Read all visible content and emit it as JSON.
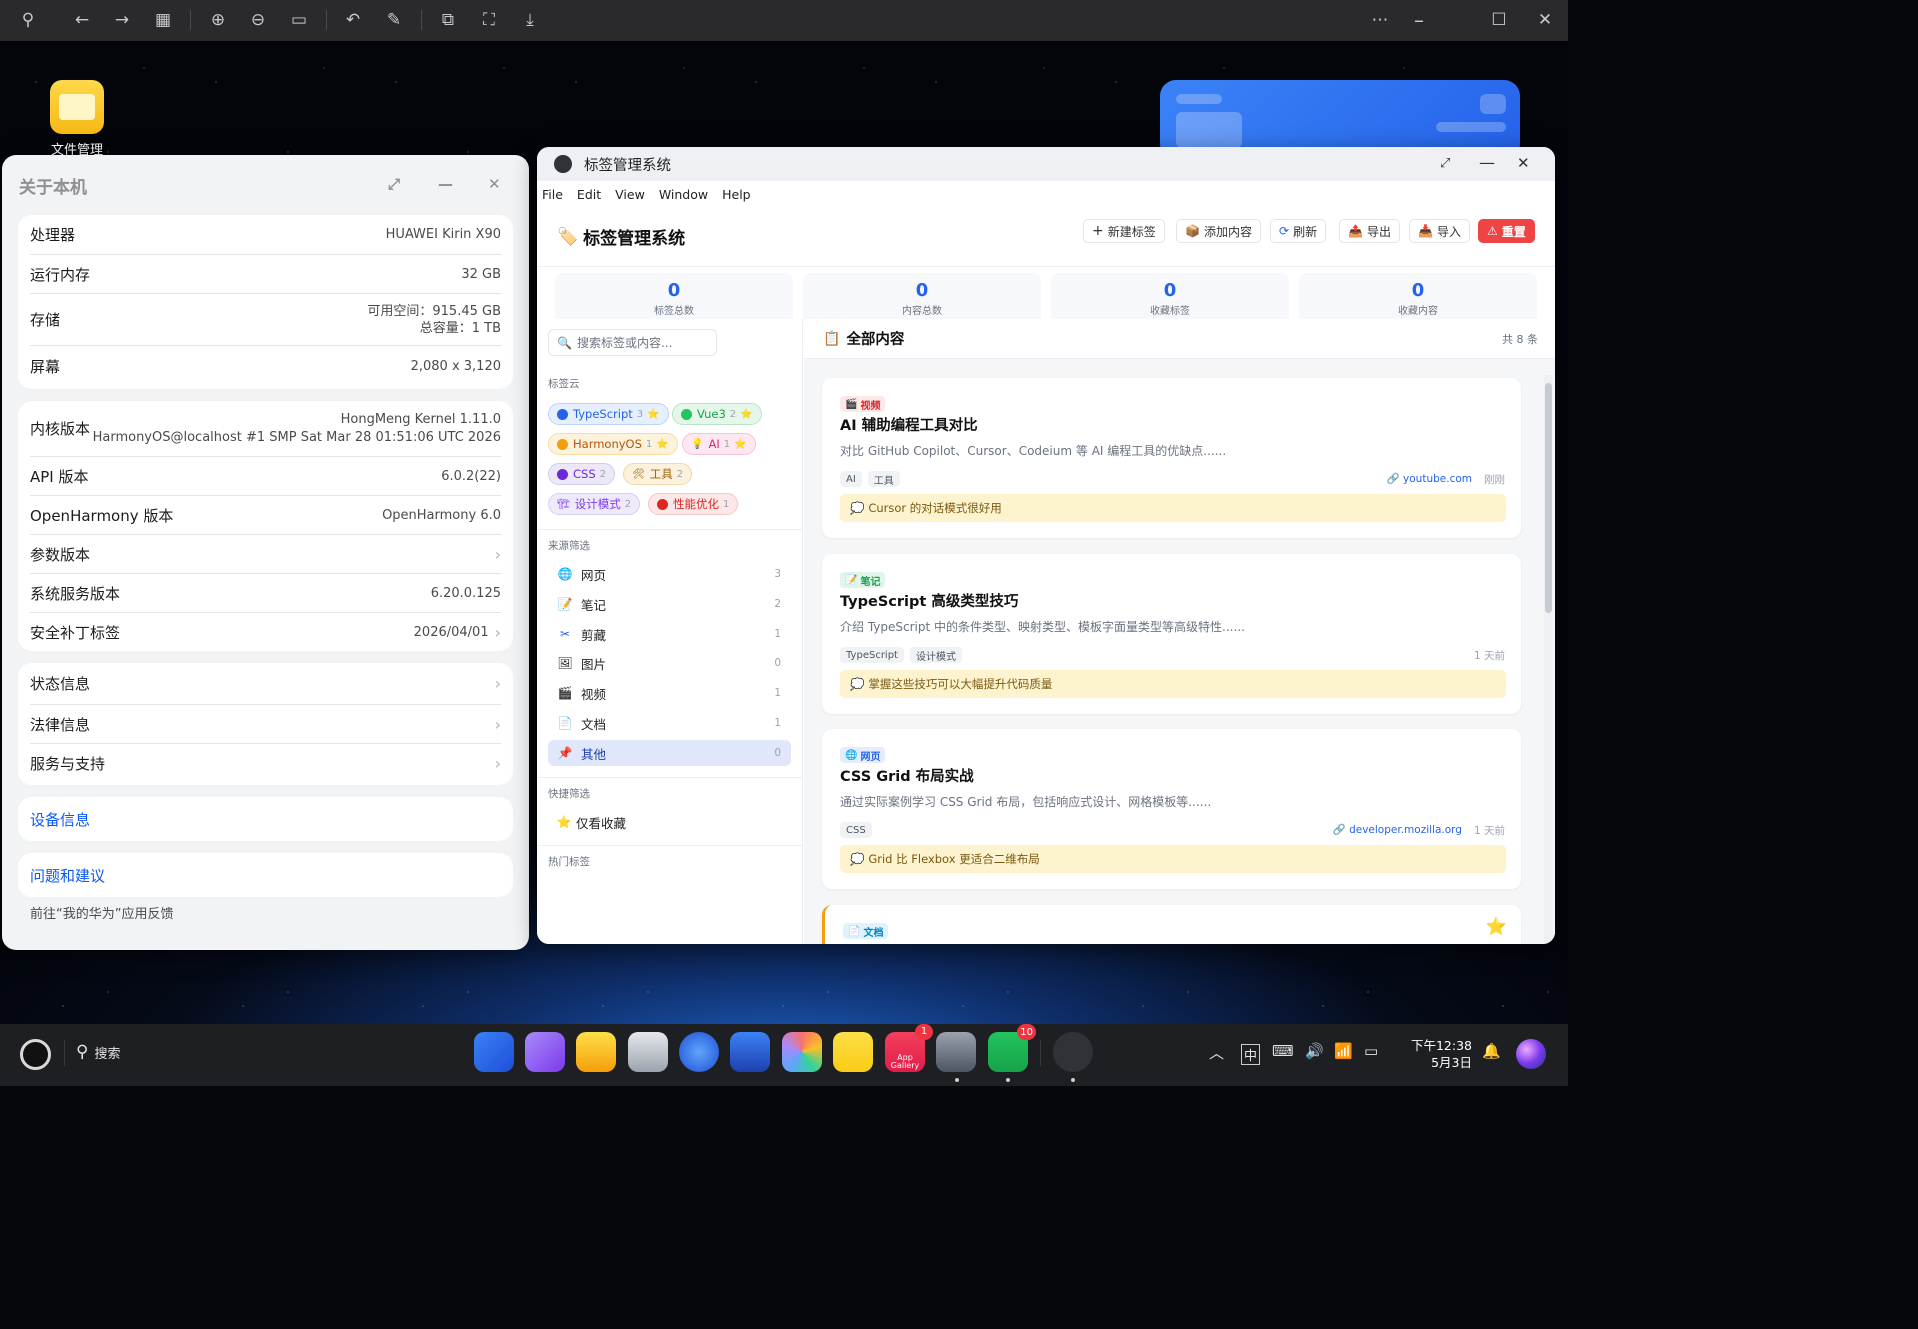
{
  "topbar": {
    "icons": [
      "pin-icon",
      "back-icon",
      "forward-icon",
      "grid-icon",
      "zoom-in-icon",
      "zoom-out-icon",
      "actual-size-icon",
      "rotate-icon",
      "edit-icon",
      "crop-icon",
      "fullscreen-icon",
      "download-icon",
      "more-icon",
      "minimize-icon",
      "maximize-icon",
      "close-icon"
    ]
  },
  "desktop": {
    "file_manager_label": "文件管理"
  },
  "about": {
    "title": "关于本机",
    "hardware": [
      {
        "key": "处理器",
        "value": "HUAWEI Kirin X90"
      },
      {
        "key": "运行内存",
        "value": "32 GB"
      },
      {
        "key": "存储",
        "value": "可用空间：915.45 GB",
        "value2": "总容量：1 TB"
      },
      {
        "key": "屏幕",
        "value": "2,080 x 3,120"
      }
    ],
    "software": [
      {
        "key": "内核版本",
        "value": "HongMeng Kernel 1.11.0",
        "value2": "HarmonyOS@localhost #1 SMP Sat Mar 28 01:51:06 UTC 2026"
      },
      {
        "key": "API 版本",
        "value": "6.0.2(22)"
      },
      {
        "key": "OpenHarmony 版本",
        "value": "OpenHarmony 6.0"
      },
      {
        "key": "参数版本",
        "value": ""
      },
      {
        "key": "系统服务版本",
        "value": "6.20.0.125"
      },
      {
        "key": "安全补丁标签",
        "value": "2026/04/01"
      }
    ],
    "info": [
      {
        "key": "状态信息"
      },
      {
        "key": "法律信息"
      },
      {
        "key": "服务与支持"
      }
    ],
    "device_info": "设备信息",
    "feedback": "问题和建议",
    "feedback_hint": "前往“我的华为”应用反馈"
  },
  "tagwin": {
    "window_title": "标签管理系统",
    "menu": [
      "File",
      "Edit",
      "View",
      "Window",
      "Help"
    ],
    "app_title": "标签管理系统",
    "buttons": {
      "new_tag": "新建标签",
      "add_content": "添加内容",
      "refresh": "刷新",
      "export": "导出",
      "import": "导入",
      "reset": "重置"
    },
    "stats": [
      {
        "value": "0",
        "label": "标签总数"
      },
      {
        "value": "0",
        "label": "内容总数"
      },
      {
        "value": "0",
        "label": "收藏标签"
      },
      {
        "value": "0",
        "label": "收藏内容"
      }
    ],
    "search_placeholder": "搜索标签或内容...",
    "tag_cloud_title": "标签云",
    "tags": [
      {
        "name": "TypeScript",
        "count": "3",
        "fav": true,
        "color": "#3b82f6"
      },
      {
        "name": "Vue3",
        "count": "2",
        "fav": true,
        "color": "#22c55e"
      },
      {
        "name": "HarmonyOS",
        "count": "1",
        "fav": true,
        "color": "#f59e0b"
      },
      {
        "name": "AI",
        "count": "1",
        "fav": true,
        "color": "#ec4899"
      },
      {
        "name": "CSS",
        "count": "2",
        "fav": false,
        "color": "#6d28d9"
      },
      {
        "name": "工具",
        "count": "2",
        "fav": false,
        "color": "#a16207"
      },
      {
        "name": "设计模式",
        "count": "2",
        "fav": false,
        "color": "#8b5cf6"
      },
      {
        "name": "性能优化",
        "count": "1",
        "fav": false,
        "color": "#ef4444"
      }
    ],
    "source_title": "来源筛选",
    "sources": [
      {
        "name": "网页",
        "count": "3"
      },
      {
        "name": "笔记",
        "count": "2"
      },
      {
        "name": "剪藏",
        "count": "1"
      },
      {
        "name": "图片",
        "count": "0"
      },
      {
        "name": "视频",
        "count": "1"
      },
      {
        "name": "文档",
        "count": "1"
      },
      {
        "name": "其他",
        "count": "0"
      }
    ],
    "quick_title": "快捷筛选",
    "quick_fav": "仅看收藏",
    "hot_title": "热门标签",
    "main_title": "全部内容",
    "total": "共 8 条",
    "items": [
      {
        "type": "视频",
        "title": "AI 辅助编程工具对比",
        "desc": "对比 GitHub Copilot、Cursor、Codeium 等 AI 编程工具的优缺点......",
        "tags": [
          "AI",
          "工具"
        ],
        "url": "youtube.com",
        "time": "刚刚",
        "note": "Cursor 的对话模式很好用"
      },
      {
        "type": "笔记",
        "title": "TypeScript 高级类型技巧",
        "desc": "介绍 TypeScript 中的条件类型、映射类型、模板字面量类型等高级特性......",
        "tags": [
          "TypeScript",
          "设计模式"
        ],
        "url": "",
        "time": "1 天前",
        "note": "掌握这些技巧可以大幅提升代码质量"
      },
      {
        "type": "网页",
        "title": "CSS Grid 布局实战",
        "desc": "通过实际案例学习 CSS Grid 布局，包括响应式设计、网格模板等......",
        "tags": [
          "CSS"
        ],
        "url": "developer.mozilla.org",
        "time": "1 天前",
        "note": "Grid 比 Flexbox 更适合二维布局"
      },
      {
        "type": "文档",
        "title": "",
        "desc": "",
        "tags": [],
        "url": "",
        "time": "",
        "note": ""
      }
    ]
  },
  "taskbar": {
    "search_label": "搜索",
    "appgallery_label": "App Gallery",
    "appgallery_badge": "1",
    "wechat_badge": "10",
    "ime": "中",
    "time": "下午12:38",
    "date": "5月3日"
  }
}
